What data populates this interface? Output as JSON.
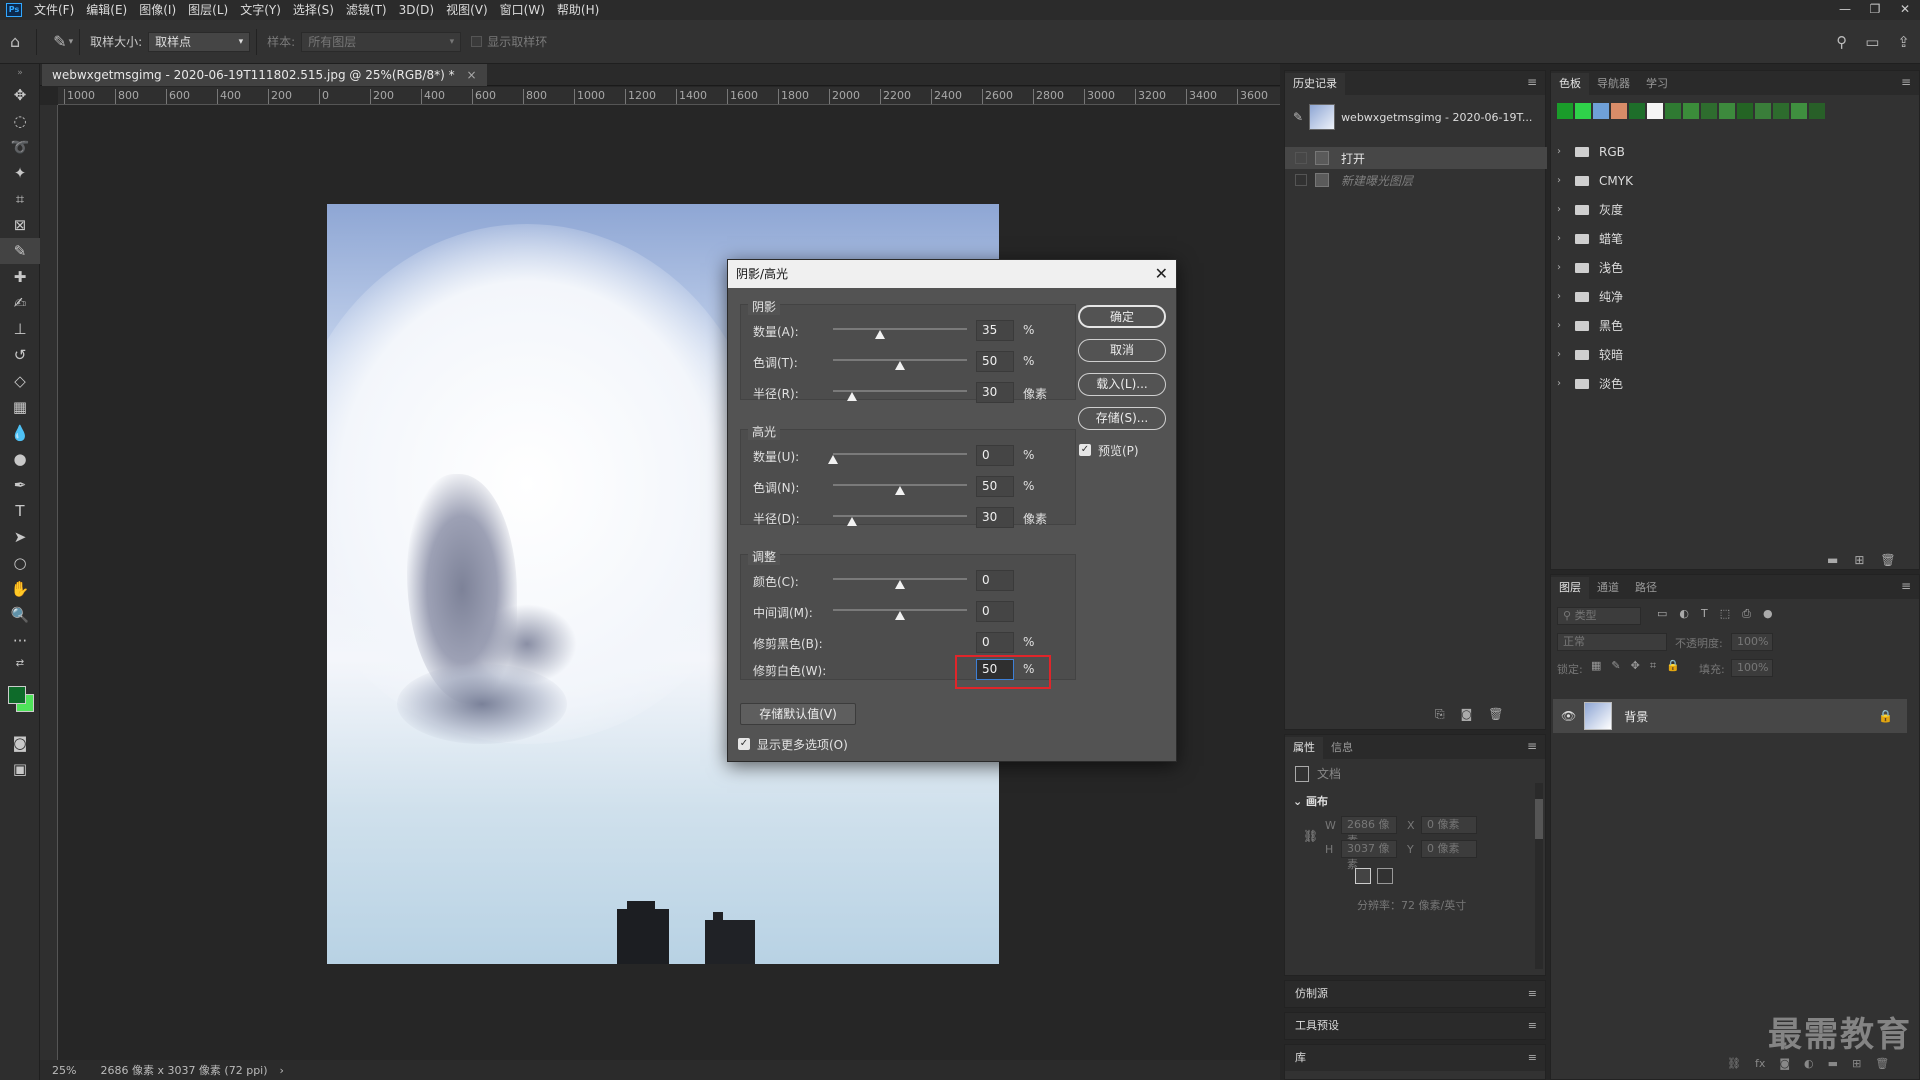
{
  "menubar": {
    "logo": "Ps",
    "items": [
      "文件(F)",
      "编辑(E)",
      "图像(I)",
      "图层(L)",
      "文字(Y)",
      "选择(S)",
      "滤镜(T)",
      "3D(D)",
      "视图(V)",
      "窗口(W)",
      "帮助(H)"
    ]
  },
  "options": {
    "sample_size_label": "取样大小:",
    "sample_size_value": "取样点",
    "sample_label": "样本:",
    "sample_value": "所有图层",
    "show_ring": "显示取样环"
  },
  "document": {
    "tab_title": "webwxgetmsgimg - 2020-06-19T111802.515.jpg @ 25%(RGB/8*) *",
    "ruler_ticks": [
      "1000",
      "800",
      "600",
      "400",
      "200",
      "0",
      "200",
      "400",
      "600",
      "800",
      "1000",
      "1200",
      "1400",
      "1600",
      "1800",
      "2000",
      "2200",
      "2400",
      "2600",
      "2800",
      "3000",
      "3200",
      "3400",
      "3600"
    ],
    "zoom": "25%",
    "size_info": "2686 像素 x 3037 像素 (72 ppi)"
  },
  "dialog": {
    "title": "阴影/高光",
    "shadow": {
      "title": "阴影",
      "amount": {
        "label": "数量(A):",
        "value": "35",
        "unit": "%",
        "level": 0.35
      },
      "tone": {
        "label": "色调(T):",
        "value": "50",
        "unit": "%",
        "level": 0.5
      },
      "radius": {
        "label": "半径(R):",
        "value": "30",
        "unit": "像素",
        "level": 0.14
      }
    },
    "highlight": {
      "title": "高光",
      "amount": {
        "label": "数量(U):",
        "value": "0",
        "unit": "%",
        "level": 0.0
      },
      "tone": {
        "label": "色调(N):",
        "value": "50",
        "unit": "%",
        "level": 0.5
      },
      "radius": {
        "label": "半径(D):",
        "value": "30",
        "unit": "像素",
        "level": 0.14
      }
    },
    "adjust": {
      "title": "调整",
      "color": {
        "label": "颜色(C):",
        "value": "0",
        "level": 0.5
      },
      "midtone": {
        "label": "中间调(M):",
        "value": "0",
        "level": 0.5
      },
      "clip_black": {
        "label": "修剪黑色(B):",
        "value": "0",
        "unit": "%"
      },
      "clip_white": {
        "label": "修剪白色(W):",
        "value": "50",
        "unit": "%"
      }
    },
    "buttons": {
      "ok": "确定",
      "cancel": "取消",
      "load": "载入(L)...",
      "save": "存储(S)..."
    },
    "preview": "预览(P)",
    "save_default": "存储默认值(V)",
    "show_more": "显示更多选项(O)",
    "highlight_color": "#e0252a"
  },
  "history": {
    "tab": "历史记录",
    "snapshot": "webwxgetmsgimg - 2020-06-19T...",
    "items": [
      "打开",
      "新建曝光图层"
    ]
  },
  "properties": {
    "tabs": [
      "属性",
      "信息"
    ],
    "doc_label": "文档",
    "canvas_title": "画布",
    "w_label": "W",
    "w_value": "2686 像素",
    "h_label": "H",
    "h_value": "3037 像素",
    "x_label": "X",
    "x_value": "0 像素",
    "y_label": "Y",
    "y_value": "0 像素",
    "resolution": "分辨率：72 像素/英寸"
  },
  "collapsed": {
    "clone": "仿制源",
    "toolpresets": "工具预设",
    "library": "库"
  },
  "swatches": {
    "tabs": [
      "色板",
      "导航器",
      "学习"
    ],
    "recent_colors": [
      "#1a9c2a",
      "#2fd24a",
      "#6fa0d8",
      "#d98c68",
      "#1e6e2a",
      "#f4f4f4",
      "#2f7a32",
      "#3b8c3a",
      "#2e6c2e",
      "#3d8a3d",
      "#246424",
      "#3a7e3a",
      "#2d6b2d",
      "#3f8f3f",
      "#285f28"
    ],
    "groups": [
      "RGB",
      "CMYK",
      "灰度",
      "蜡笔",
      "浅色",
      "纯净",
      "黑色",
      "较暗",
      "淡色"
    ]
  },
  "layers": {
    "tabs": [
      "图层",
      "通道",
      "路径"
    ],
    "filter_placeholder": "类型",
    "blend_mode": "正常",
    "opacity_label": "不透明度:",
    "opacity_value": "100%",
    "lock_label": "锁定:",
    "fill_label": "填充:",
    "fill_value": "100%",
    "layer_name": "背景"
  },
  "watermark": "最需教育",
  "colors": {
    "fg": "#0e6b2a",
    "bg": "#4fe35a"
  }
}
